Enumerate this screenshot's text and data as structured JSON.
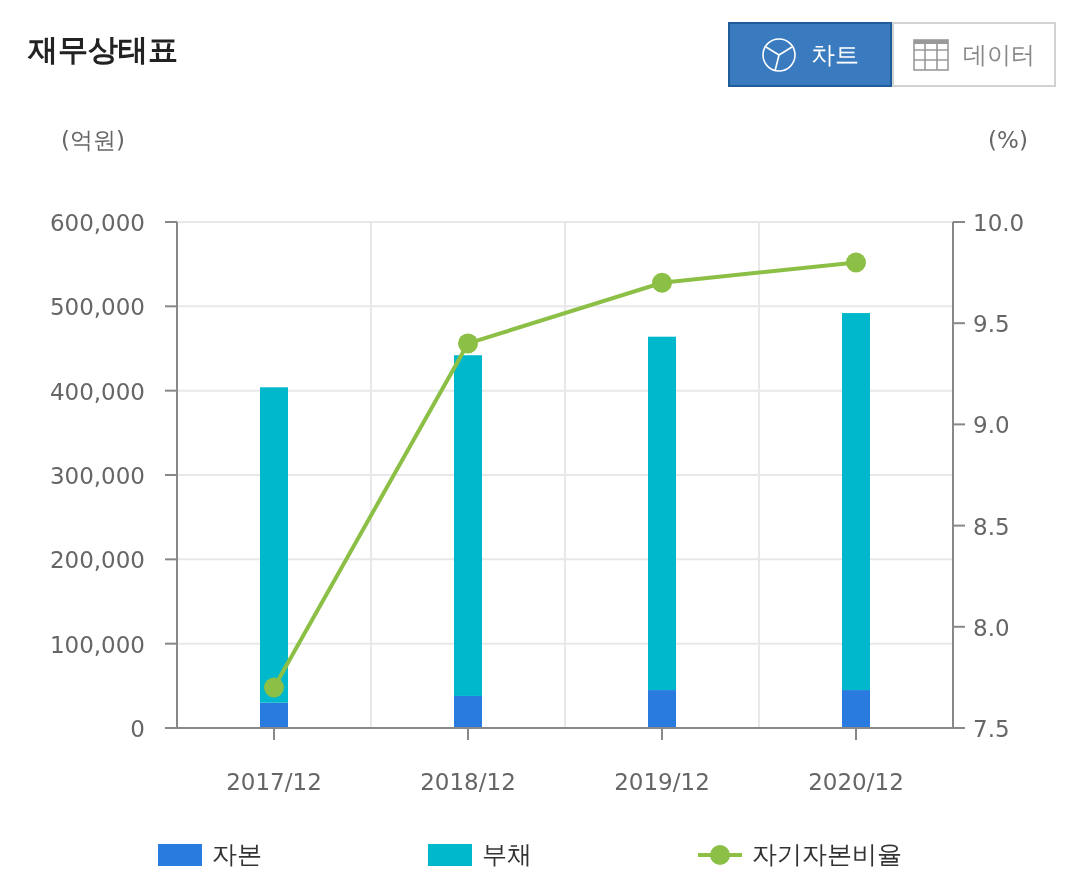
{
  "title": "재무상태표",
  "toggles": [
    {
      "label": "차트",
      "kind": "chart",
      "selected": true
    },
    {
      "label": "데이터",
      "kind": "table",
      "selected": false
    }
  ],
  "chart": {
    "left_unit": "(억원)",
    "right_unit": "(%)",
    "chart_data": {
      "type": "bar",
      "stacked": true,
      "grid": true,
      "categories": [
        "2017/12",
        "2018/12",
        "2019/12",
        "2020/12"
      ],
      "ylim": [
        0,
        600000
      ],
      "yticks": [
        {
          "value": 0,
          "label": "0"
        },
        {
          "value": 100000,
          "label": "100,000"
        },
        {
          "value": 200000,
          "label": "200,000"
        },
        {
          "value": 300000,
          "label": "300,000"
        },
        {
          "value": 400000,
          "label": "400,000"
        },
        {
          "value": 500000,
          "label": "500,000"
        },
        {
          "value": 600000,
          "label": "600,000"
        }
      ],
      "y2lim": [
        7.5,
        10
      ],
      "y2ticks": [
        {
          "value": 7.5,
          "label": "7.5"
        },
        {
          "value": 8,
          "label": "8.0"
        },
        {
          "value": 8.5,
          "label": "8.5"
        },
        {
          "value": 9,
          "label": "9.0"
        },
        {
          "value": 9.5,
          "label": "9.5"
        },
        {
          "value": 10,
          "label": "10.0"
        }
      ],
      "series": [
        {
          "name": "자본",
          "type": "bar",
          "color": "#2a7be0",
          "values": [
            30000,
            38000,
            45000,
            45000
          ]
        },
        {
          "name": "부채",
          "type": "bar",
          "color": "#00b8cc",
          "values": [
            374000,
            404000,
            419000,
            447000
          ]
        },
        {
          "name": "자기자본비율",
          "type": "line",
          "axis": "y2",
          "marker": true,
          "color": "#8cbf45",
          "values": [
            7.7,
            9.4,
            9.7,
            9.8
          ]
        }
      ]
    }
  }
}
